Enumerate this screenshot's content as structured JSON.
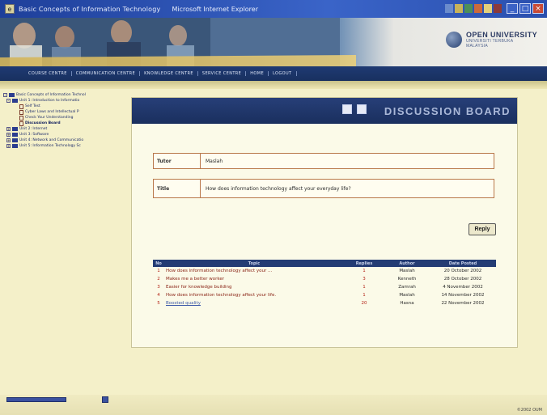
{
  "window": {
    "title": "Basic Concepts of Information Technology",
    "browser": "Microsoft Internet Explorer",
    "icon": "ie-icon",
    "controls": [
      "minimize-icon",
      "maximize-icon",
      "close-icon"
    ]
  },
  "logo": {
    "line1": "OPEN UNIVERSITY",
    "line2": "UNIVERSITI TERBUKA",
    "line3": "MALAYSIA"
  },
  "nav": {
    "items": [
      "COURSE CENTRE",
      "COMMUNICATION CENTRE",
      "KNOWLEDGE CENTRE",
      "SERVICE CENTRE",
      "HOME",
      "LOGOUT"
    ]
  },
  "tree": {
    "root": "Basic Concepts of Information Technol",
    "unit1": "Unit 1: Introduction to Informatio",
    "unit1_items": [
      "Self Test",
      "Cyber Laws and Intellectual P",
      "Check Your Understanding",
      "Discussion Board"
    ],
    "units": [
      "Unit 2: Internet",
      "Unit 3: Software",
      "Unit 4: Network and Communicatio",
      "Unit 5: Information Technology Sc"
    ]
  },
  "board": {
    "title": "DISCUSSION BOARD",
    "tutor_label": "Tutor",
    "tutor_value": "Maslah",
    "title_label": "Title",
    "title_value": "How does information technology affect your everyday life?",
    "reply_label": "Reply"
  },
  "threads": {
    "headers": [
      "No",
      "Topic",
      "Replies",
      "Author",
      "Date Posted"
    ],
    "rows": [
      {
        "no": "1",
        "topic": "How does information technology affect your ...",
        "replies": "1",
        "author": "Maslah",
        "date": "20 October 2002"
      },
      {
        "no": "2",
        "topic": "Makes me a better worker",
        "replies": "3",
        "author": "Kenneth",
        "date": "28 October 2002"
      },
      {
        "no": "3",
        "topic": "Easier for knowledge building",
        "replies": "1",
        "author": "Zamrah",
        "date": "4 November 2002"
      },
      {
        "no": "4",
        "topic": "How does information technology affect your life.",
        "replies": "1",
        "author": "Maslah",
        "date": "14 November 2002"
      },
      {
        "no": "5",
        "topic": "Boosted quality",
        "replies": "20",
        "author": "Hasna",
        "date": "22 November 2002"
      }
    ]
  },
  "status": {
    "copyright": "©2002 OUM"
  },
  "colors": {
    "accent_navy": "#243c74",
    "page_cream": "#f4f0c9",
    "field_border": "#b9784a",
    "topic_red": "#8a2416"
  }
}
